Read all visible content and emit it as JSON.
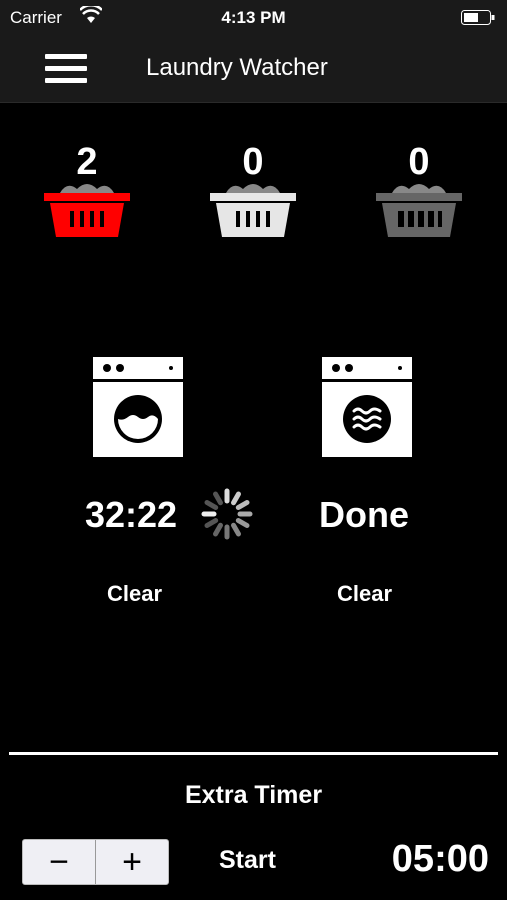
{
  "status_bar": {
    "carrier": "Carrier",
    "time": "4:13 PM"
  },
  "nav": {
    "title": "Laundry Watcher"
  },
  "baskets": [
    {
      "count": "2",
      "color": "#ff0000"
    },
    {
      "count": "0",
      "color": "#e6e6e6"
    },
    {
      "count": "0",
      "color": "#666666"
    }
  ],
  "machines": [
    {
      "type": "washer",
      "timer": "32:22",
      "clear_label": "Clear",
      "running": true
    },
    {
      "type": "dryer",
      "timer": "Done",
      "clear_label": "Clear",
      "running": false
    }
  ],
  "extra_timer": {
    "title": "Extra Timer",
    "decrement_label": "−",
    "increment_label": "+",
    "start_label": "Start",
    "time": "05:00"
  }
}
